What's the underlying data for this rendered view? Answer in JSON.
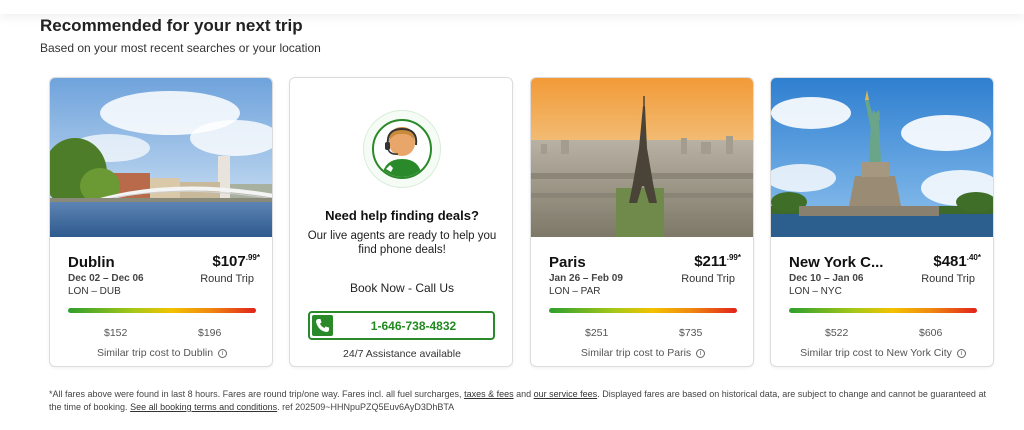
{
  "section": {
    "title": "Recommended for your next trip",
    "subtitle": "Based on your most recent searches or your location"
  },
  "cards": [
    {
      "destination": "Dublin",
      "dates": "Dec 02 – Dec 06",
      "route": "LON – DUB",
      "price_main": "$107",
      "price_cents": ".99",
      "price_mark": "*",
      "price_type": "Round Trip",
      "range_low": "$152",
      "range_high": "$196",
      "similar": "Similar trip cost to Dublin",
      "info_icon": "i"
    },
    {
      "destination": "Paris",
      "dates": "Jan 26 – Feb 09",
      "route": "LON – PAR",
      "price_main": "$211",
      "price_cents": ".99",
      "price_mark": "*",
      "price_type": "Round Trip",
      "range_low": "$251",
      "range_high": "$735",
      "similar": "Similar trip cost to Paris",
      "info_icon": "i"
    },
    {
      "destination": "New York C...",
      "dates": "Dec 10 – Jan 06",
      "route": "LON – NYC",
      "price_main": "$481",
      "price_cents": ".40",
      "price_mark": "*",
      "price_type": "Round Trip",
      "range_low": "$522",
      "range_high": "$606",
      "similar": "Similar trip cost to New York City",
      "info_icon": "i"
    }
  ],
  "help": {
    "title": "Need help finding deals?",
    "body": "Our live agents are ready to help you find phone deals!",
    "book_now": "Book Now - Call Us",
    "phone": "1-646-738-4832",
    "assist": "24/7 Assistance available",
    "agent_icon": "support-agent-icon",
    "phone_icon": "phone-icon"
  },
  "footnote": {
    "part1": "*All fares above were found in last 8 hours. Fares are round trip/one way. Fares incl. all fuel surcharges,",
    "link1": "taxes & fees",
    "part2": "and",
    "link2": "our service fees",
    "part3": ". Displayed fares are based on historical data, are subject to change and cannot be guaranteed at the time of booking.",
    "link3": "See all booking terms and conditions",
    "part4": ". ref 202509~HHNpuPZQ5Euv6AyD3DhBTA"
  },
  "colors": {
    "accent_green": "#2a8a2a",
    "range_low_color": "#2e9e2e",
    "range_high_color": "#e2231a"
  }
}
